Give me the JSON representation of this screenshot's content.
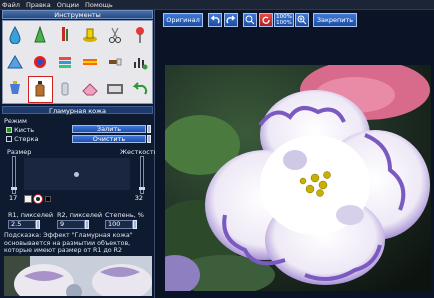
{
  "menu": [
    "Файл",
    "Правка",
    "Опции",
    "Помощь"
  ],
  "tools_panel": {
    "title": "Инструменты",
    "icons": [
      "drop-tool-icon",
      "cone-tool-icon",
      "pencil-tool-icon",
      "stamp-tool-icon",
      "scissors-tool-icon",
      "pin-tool-icon",
      "triangle-tool-icon",
      "gradient-tool-icon",
      "color-picker-icon",
      "rainbow-tool-icon",
      "brush-tool-icon",
      "equalizer-icon",
      "cup-tool-icon",
      "bottle-tool-icon",
      "tube-tool-icon",
      "eraser-tool-icon",
      "film-tool-icon",
      "undo-icon"
    ]
  },
  "glam_panel": {
    "title": "Гламурная кожа",
    "mode_label": "Режим",
    "mode_brush": "Кисть",
    "mode_eraser": "Стерка",
    "fill_button": "Залить",
    "clear_button": "Очистить",
    "size_label": "Размер",
    "hardness_label": "Жесткость",
    "size_value": "17",
    "hardness_value": "32",
    "r1_label": "R1, пикселей",
    "r2_label": "R2, пикселей",
    "degree_label": "Степень, %",
    "r1_value": "2.5",
    "r2_value": "9",
    "degree_value": "100",
    "hint": "Подсказка: Эффект \"Гламурная кожа\" основывается на размытии объектов, которые имеют размер от R1 до R2"
  },
  "topbar": {
    "original_button": "Оригинал",
    "zoom_text_top": "100%",
    "zoom_text_bottom": "100%",
    "pin_button": "Закрепить"
  }
}
